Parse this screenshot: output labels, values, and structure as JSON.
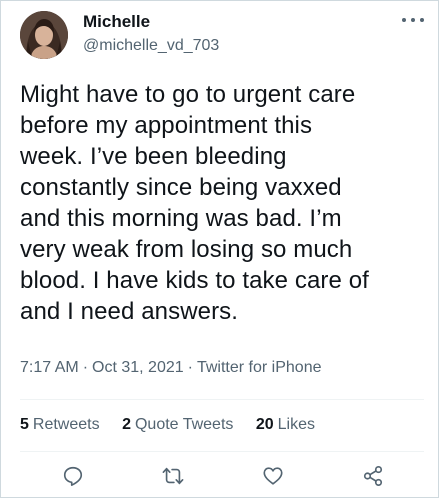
{
  "author": {
    "display_name": "Michelle",
    "handle": "@michelle_vd_703",
    "avatar_icon": "profile-photo"
  },
  "tweet": {
    "text": "Might have to go to urgent care\nbefore my appointment this\nweek. I’ve been bleeding\nconstantly since being vaxxed\nand this morning was bad. I’m\nvery weak from losing so much\nblood. I have kids to take care of\nand I need answers.",
    "time": "7:17 AM",
    "date": "Oct 31, 2021",
    "source": "Twitter for iPhone",
    "separator": "·"
  },
  "stats": {
    "retweets_count": "5",
    "retweets_label": "Retweets",
    "quotes_count": "2",
    "quotes_label": "Quote Tweets",
    "likes_count": "20",
    "likes_label": "Likes"
  },
  "actions": {
    "reply_icon": "reply-icon",
    "retweet_icon": "retweet-icon",
    "like_icon": "like-icon",
    "share_icon": "share-icon"
  },
  "colors": {
    "text_primary": "#0f1419",
    "text_secondary": "#536471",
    "divider": "#eff3f4"
  }
}
